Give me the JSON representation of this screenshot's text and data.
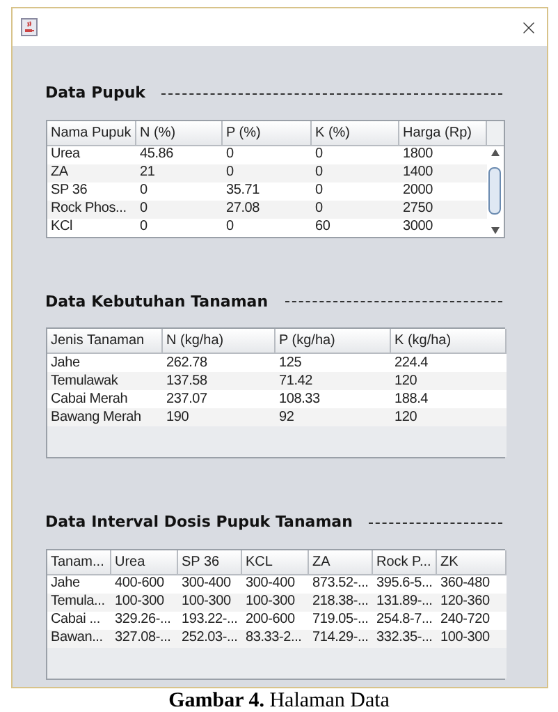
{
  "sections": [
    {
      "title": "Data Pupuk",
      "kind": "scrolling",
      "columns": [
        "Nama Pupuk",
        "N (%)",
        "P (%)",
        "K (%)",
        "Harga (Rp)"
      ],
      "rows": [
        [
          "Urea",
          "45.86",
          "0",
          "0",
          "1800"
        ],
        [
          "ZA",
          "21",
          "0",
          "0",
          "1400"
        ],
        [
          "SP 36",
          "0",
          "35.71",
          "0",
          "2000"
        ],
        [
          "Rock Phos...",
          "0",
          "27.08",
          "0",
          "2750"
        ],
        [
          "KCl",
          "0",
          "0",
          "60",
          "3000"
        ]
      ]
    },
    {
      "title": "Data Kebutuhan Tanaman",
      "kind": "plain",
      "columns": [
        "Jenis Tanaman",
        "N (kg/ha)",
        "P (kg/ha)",
        "K (kg/ha)"
      ],
      "rows": [
        [
          "Jahe",
          "262.78",
          "125",
          "224.4"
        ],
        [
          "Temulawak",
          "137.58",
          "71.42",
          "120"
        ],
        [
          "Cabai Merah",
          "237.07",
          "108.33",
          "188.4"
        ],
        [
          "Bawang Merah",
          "190",
          "92",
          "120"
        ]
      ]
    },
    {
      "title": "Data Interval Dosis Pupuk Tanaman",
      "kind": "plain",
      "columns": [
        "Tanam...",
        "Urea",
        "SP 36",
        "KCL",
        "ZA",
        "Rock P...",
        "ZK"
      ],
      "rows": [
        [
          "Jahe",
          "400-600",
          "300-400",
          "300-400",
          "873.52-...",
          "395.6-5...",
          "360-480"
        ],
        [
          "Temula...",
          "100-300",
          "100-300",
          "100-300",
          "218.38-...",
          "131.89-...",
          "120-360"
        ],
        [
          "Cabai ...",
          "329.26-...",
          "193.22-...",
          "200-600",
          "719.05-...",
          "254.8-7...",
          "240-720"
        ],
        [
          "Bawan...",
          "327.08-...",
          "252.03-...",
          "83.33-2...",
          "714.29-...",
          "332.35-...",
          "100-300"
        ]
      ]
    }
  ],
  "caption": {
    "label": "Gambar 4.",
    "text": "Halaman Data"
  }
}
